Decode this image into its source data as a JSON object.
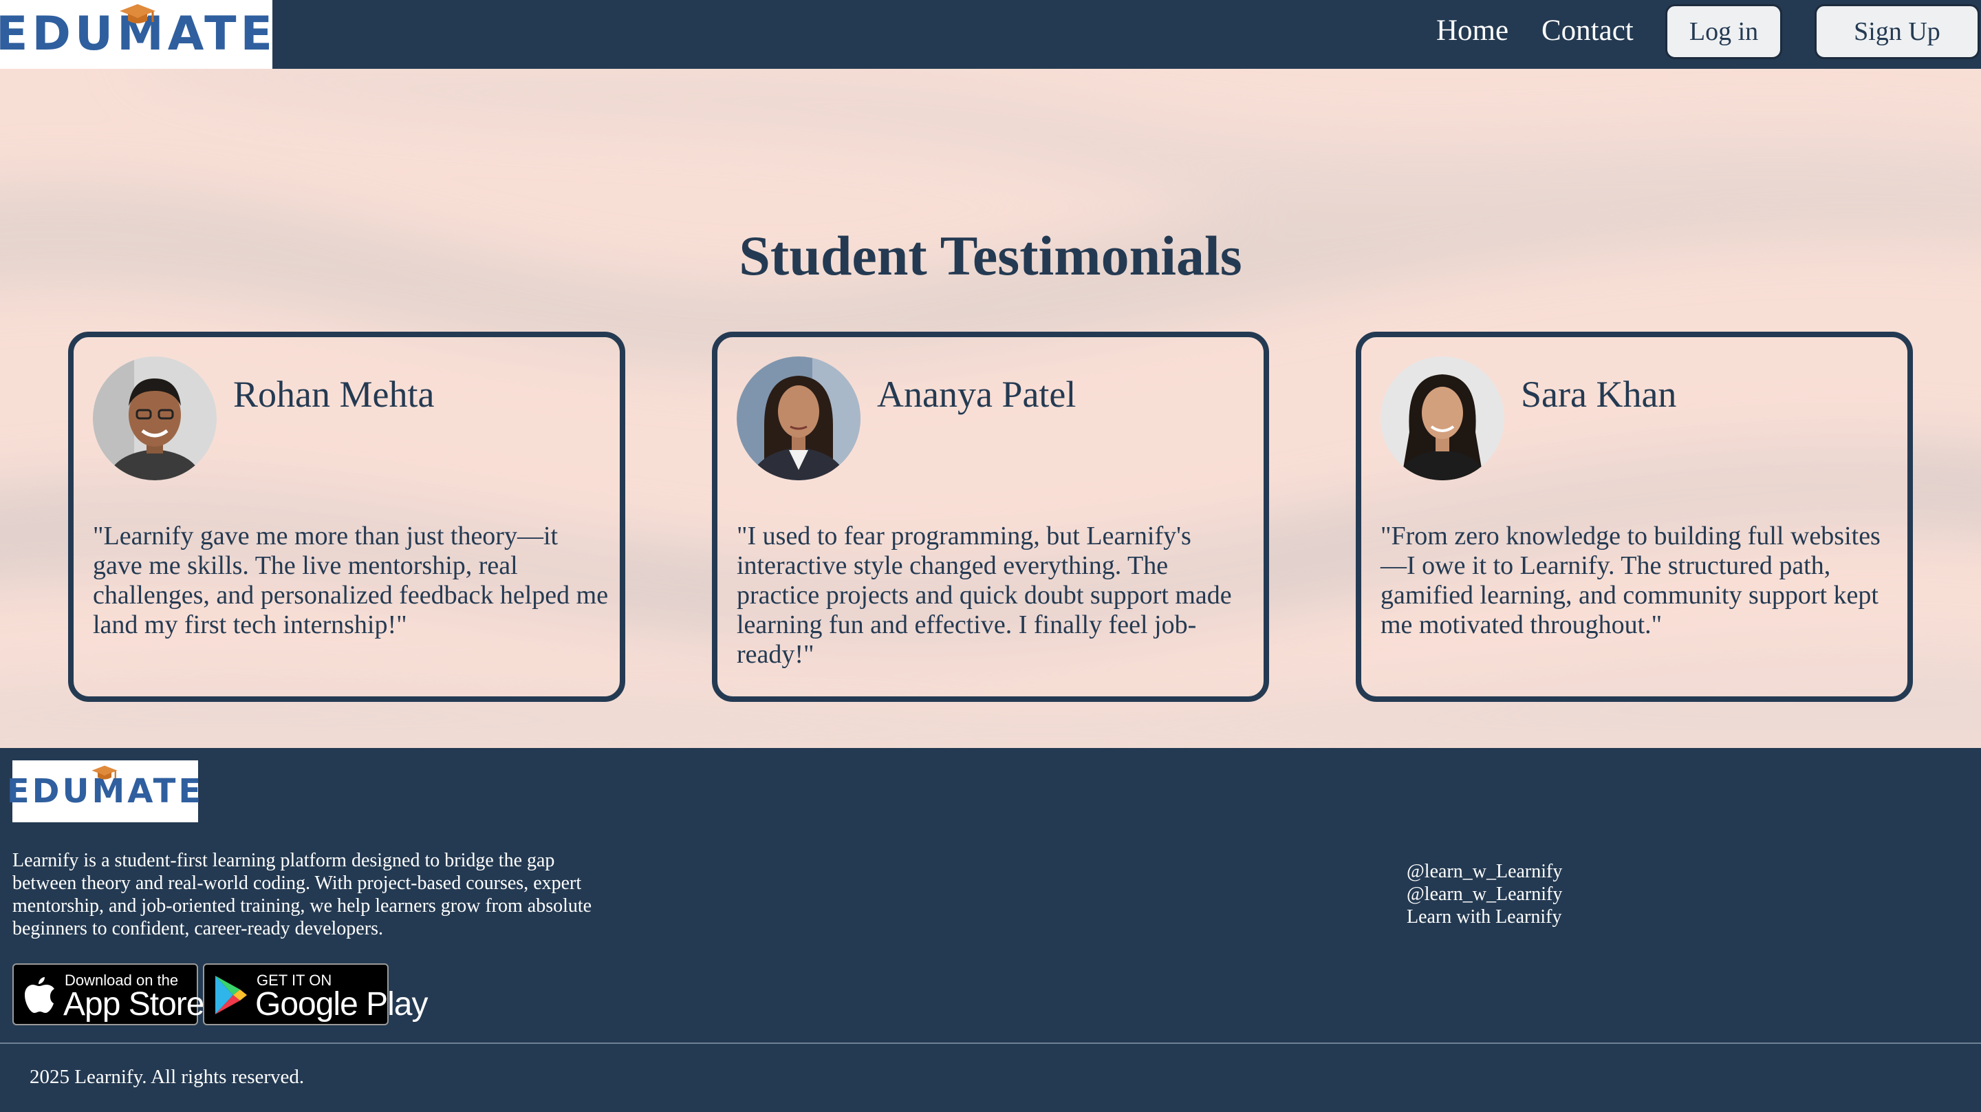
{
  "header": {
    "logo_text": "EDUMATE",
    "nav": {
      "home": "Home",
      "contact": "Contact"
    },
    "buttons": {
      "login": "Log in",
      "signup": "Sign Up"
    }
  },
  "testimonials": {
    "title": "Student Testimonials",
    "cards": [
      {
        "name": "Rohan Mehta",
        "quote": "\"Learnify gave me more than just theory—it gave me skills. The live mentorship, real challenges, and personalized feedback helped me land my first tech internship!\""
      },
      {
        "name": "Ananya Patel",
        "quote": "\"I used to fear programming, but Learnify's interactive style changed everything. The practice projects and quick doubt support made learning fun and effective. I finally feel job-ready!\""
      },
      {
        "name": "Sara Khan",
        "quote": "\"From zero knowledge to building full websites—I owe it to Learnify. The structured path, gamified learning, and community support kept me motivated throughout.\""
      }
    ]
  },
  "footer": {
    "logo_text": "EDUMATE",
    "about": "Learnify is a student-first learning platform designed to bridge the gap between theory and real-world coding. With project-based courses, expert mentorship, and job-oriented training, we help learners grow from absolute beginners to confident, career-ready developers.",
    "app_store": {
      "small": "Download on the",
      "big": "App Store"
    },
    "google_play": {
      "small": "GET IT ON",
      "big": "Google Play"
    },
    "social": [
      "@learn_w_Learnify",
      "@learn_w_Learnify",
      "Learn with Learnify"
    ],
    "copyright": "2025 Learnify. All rights reserved."
  },
  "colors": {
    "navy": "#243a52",
    "hero_bg": "#f8dfd6",
    "logo_blue": "#2f5f9e",
    "logo_cap": "#e08a3c"
  },
  "icons": [
    "graduation-cap-icon",
    "apple-icon",
    "google-play-icon"
  ]
}
